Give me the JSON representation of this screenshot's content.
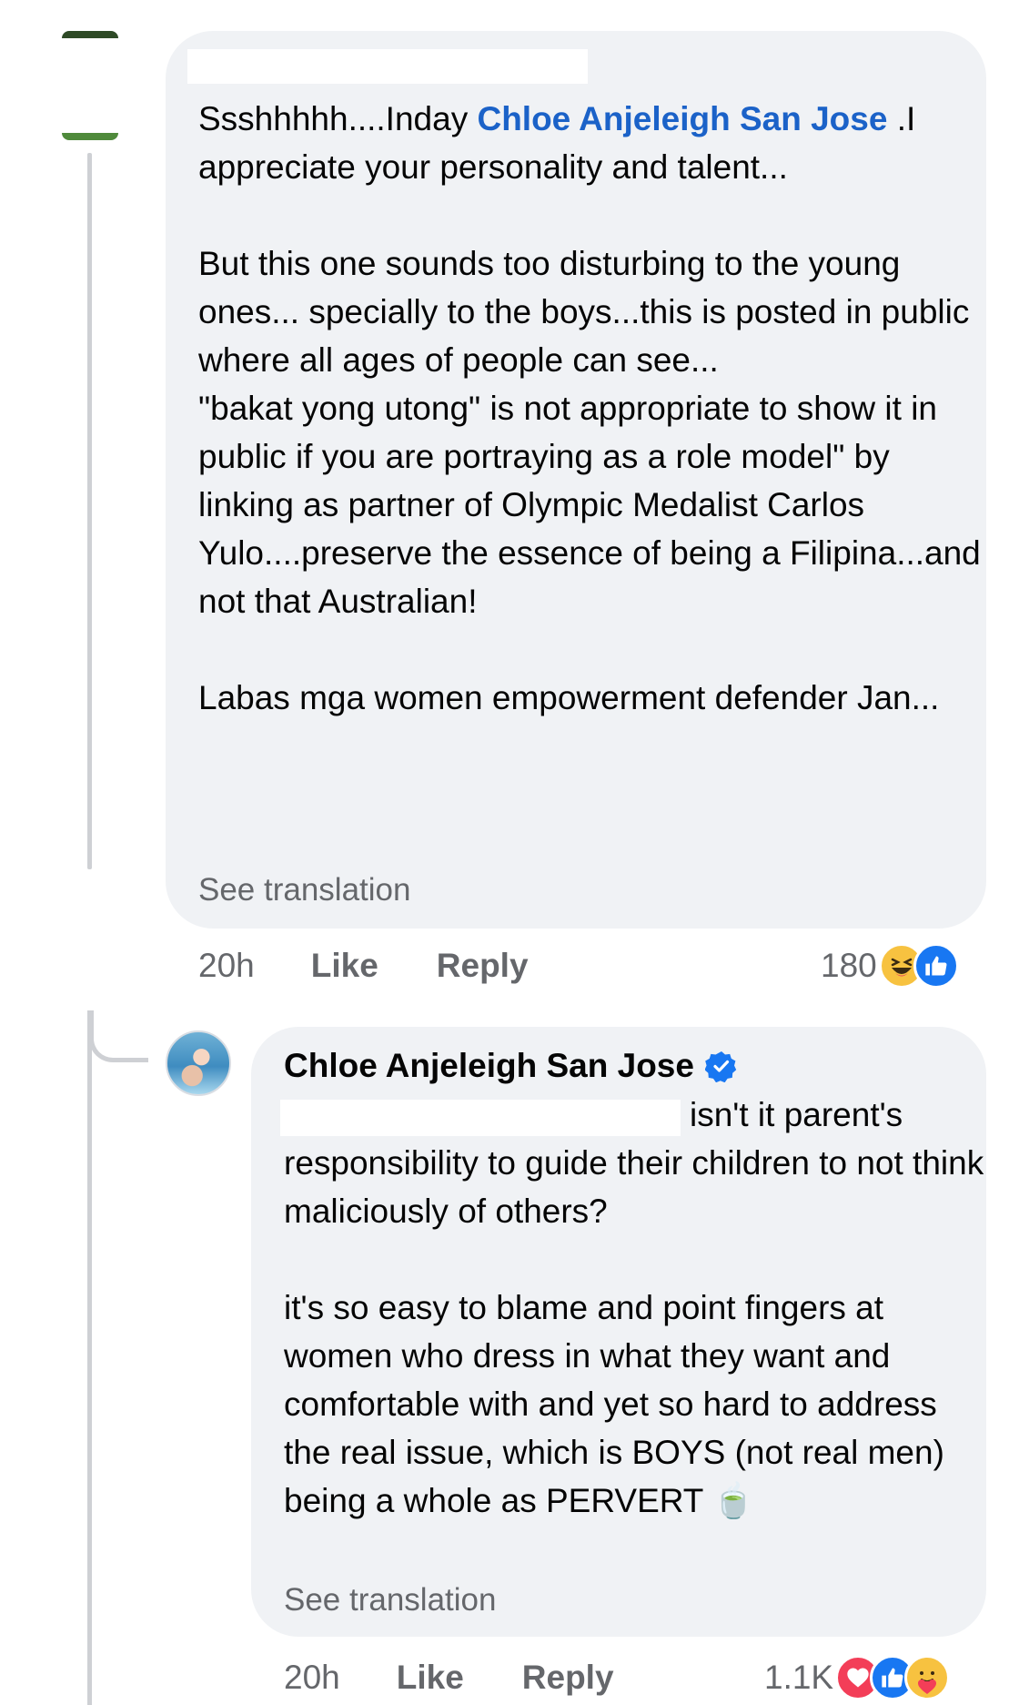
{
  "comment_1": {
    "mention_name": "Chloe Anjeleigh San Jose",
    "text_before_mention": "Ssshhhhh....Inday ",
    "text_after_mention": " .I appreciate your personality and talent...\n\nBut this one sounds too disturbing to the young ones... specially to the boys...this is posted in public where all ages of people can see...\n\"bakat yong utong\" is not appropriate to show it in public if you are portraying as a role model\" by linking as partner of Olympic Medalist Carlos Yulo....preserve the essence of being a Filipina...and not that Australian!\n\nLabas mga women empowerment defender Jan...",
    "see_translation": "See translation",
    "timestamp": "20h",
    "like_label": "Like",
    "reply_label": "Reply",
    "reaction_count": "180",
    "reactions": [
      "haha-icon",
      "like-icon"
    ]
  },
  "comment_2": {
    "author": "Chloe Anjeleigh San Jose",
    "verified": true,
    "text_first_line": "isn't it parent's",
    "text_rest": "responsibility to guide their children to not think maliciously of others?\n\nit's so easy to blame and point fingers at women who dress in what they want and comfortable with and yet so hard to address the real issue, which is BOYS (not real men) being a whole as PERVERT ",
    "emoji": "🍵",
    "see_translation": "See translation",
    "timestamp": "20h",
    "like_label": "Like",
    "reply_label": "Reply",
    "reaction_count": "1.1K",
    "reactions": [
      "love-icon",
      "like-icon",
      "care-icon"
    ]
  },
  "colors": {
    "bubble_bg": "#f0f2f5",
    "mention": "#1b62c8",
    "secondary_text": "#65676b",
    "like_blue": "#1877f2",
    "love_red": "#f33e58",
    "haha_yellow": "#f7c240"
  }
}
